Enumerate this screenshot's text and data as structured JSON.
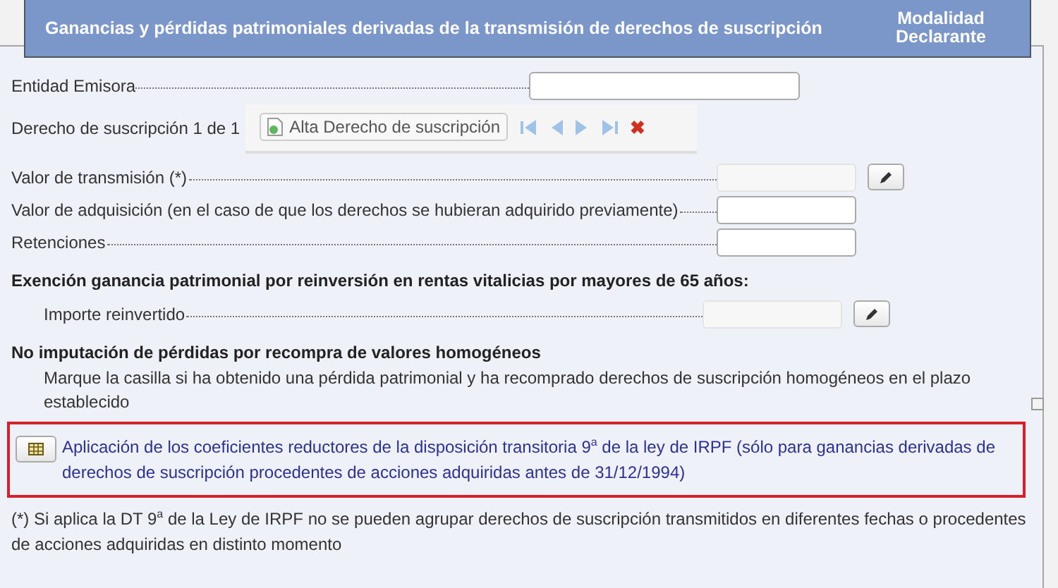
{
  "header": {
    "title": "Ganancias y pérdidas patrimoniales derivadas de la transmisión de derechos de suscripción",
    "mode": "Modalidad Declarante"
  },
  "issuer": {
    "label": "Entidad Emisora"
  },
  "record": {
    "label": "Derecho de suscripción 1 de 1",
    "add_button": "Alta Derecho de suscripción",
    "delete_button": "✖"
  },
  "amounts": [
    {
      "label": "Valor de transmisión (*)",
      "kind": "calculated"
    },
    {
      "label": "Valor de adquisición (en el caso de que los derechos se hubieran adquirido previamente)",
      "kind": "input"
    },
    {
      "label": "Retenciones",
      "kind": "input"
    }
  ],
  "exemption": {
    "heading": "Exención ganancia patrimonial por reinversión en rentas vitalicias por mayores de 65 años:",
    "field": {
      "label": "Importe reinvertido",
      "kind": "calculated"
    }
  },
  "no_imputation": {
    "heading": "No imputación de pérdidas por recompra de valores homogéneos",
    "text": "Marque la casilla si ha obtenido una pérdida patrimonial y ha recomprado derechos de suscripción homogéneos en el plazo establecido",
    "checked": false
  },
  "coefficients": {
    "link": "Aplicación de los coeficientes reductores de la disposición transitoria 9$^{a}$ de la ley de IRPF (sólo para ganancias derivadas de derechos de suscripción procedentes de acciones adquiridas antes de 31/12/1994)",
    "highlighted": true
  },
  "footnote": "(*) Si aplica la DT 9$^{a}$ de la Ley de IRPF no se pueden agrupar derechos de suscripción transmitidos en diferentes fechas o procedentes de acciones adquiridas en distinto momento"
}
